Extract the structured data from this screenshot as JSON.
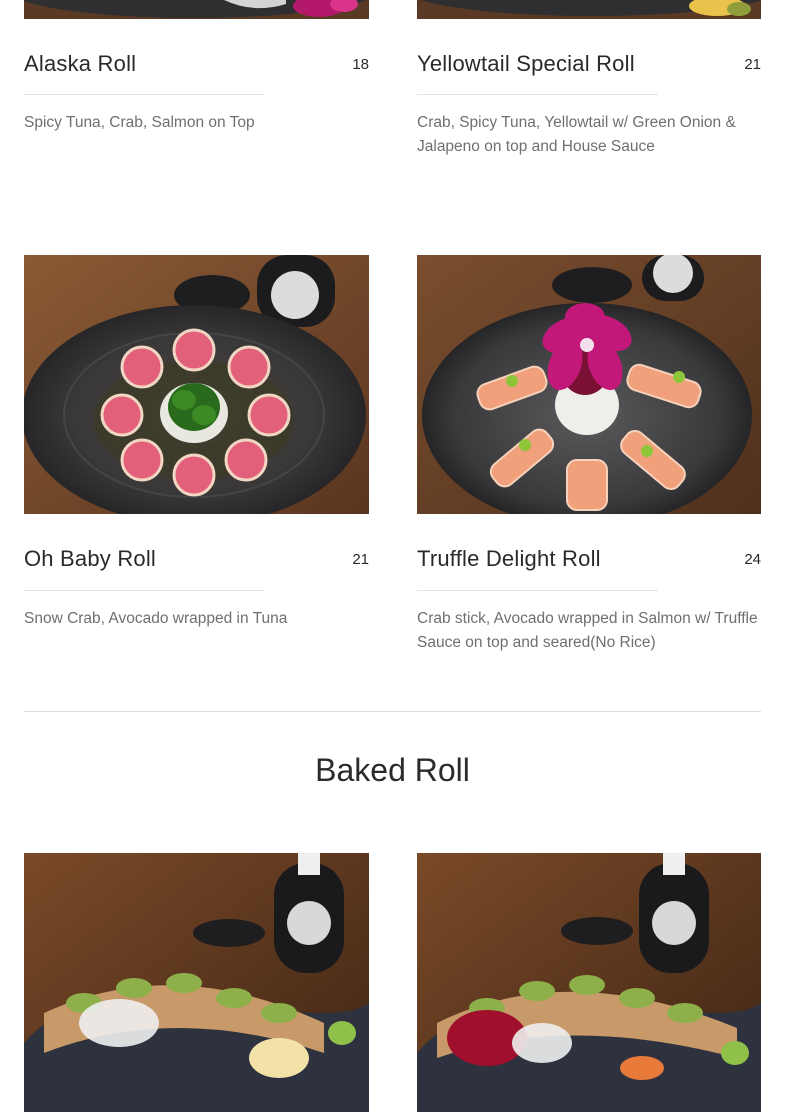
{
  "menu": {
    "items": [
      {
        "name": "Alaska Roll",
        "price": "18",
        "description": "Spicy Tuna, Crab, Salmon on Top"
      },
      {
        "name": "Yellowtail Special Roll",
        "price": "21",
        "description": "Crab, Spicy Tuna, Yellowtail w/ Green Onion & Jalapeno on top and House Sauce"
      },
      {
        "name": "Oh Baby Roll",
        "price": "21",
        "description": "Snow Crab, Avocado wrapped in Tuna"
      },
      {
        "name": "Truffle Delight Roll",
        "price": "24",
        "description": "Crab stick, Avocado wrapped in Salmon w/ Truffle Sauce on top and seared(No Rice)"
      }
    ],
    "next_section": {
      "title": "Baked Roll"
    }
  },
  "colors": {
    "table_wood": "#6b4428",
    "plate_dark": "#2f2f31",
    "tuna_pink": "#e2607a",
    "orchid": "#c2187a",
    "text_dark": "#2a2a2a",
    "text_muted": "#6f6f6f"
  }
}
